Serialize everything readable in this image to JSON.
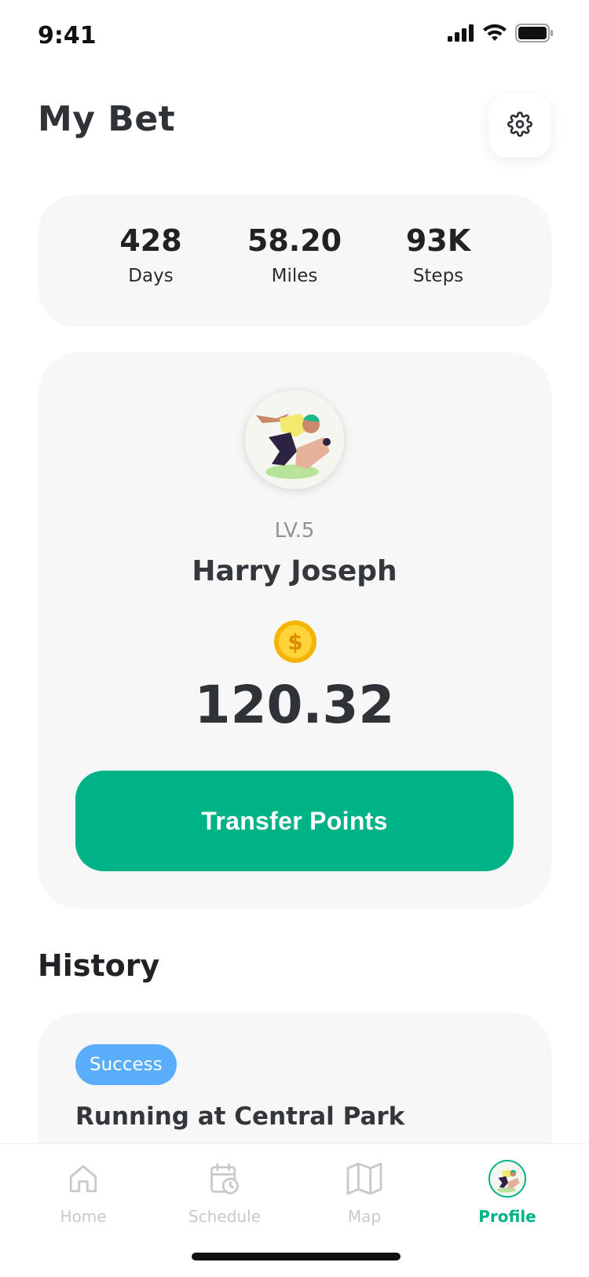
{
  "status_bar": {
    "time": "9:41",
    "icons": [
      "signal-icon",
      "wifi-icon",
      "battery-icon"
    ]
  },
  "header": {
    "title": "My Bet",
    "settings_icon": "gear-icon"
  },
  "stats": [
    {
      "value": "428",
      "label": "Days"
    },
    {
      "value": "58.20",
      "label": "Miles"
    },
    {
      "value": "93K",
      "label": "Steps"
    }
  ],
  "profile": {
    "level": "LV.5",
    "name": "Harry Joseph",
    "coin_icon": "dollar-coin-icon",
    "points": "120.32",
    "transfer_label": "Transfer Points"
  },
  "history": {
    "title": "History",
    "items": [
      {
        "status": "Success",
        "title": "Running at Central Park"
      }
    ]
  },
  "nav": {
    "items": [
      {
        "label": "Home",
        "icon": "home-icon",
        "active": false
      },
      {
        "label": "Schedule",
        "icon": "calendar-clock-icon",
        "active": false
      },
      {
        "label": "Map",
        "icon": "map-icon",
        "active": false
      },
      {
        "label": "Profile",
        "icon": "avatar-icon",
        "active": true
      }
    ]
  },
  "colors": {
    "accent": "#00b386",
    "badge": "#5aadfa",
    "card_bg": "#f7f7f7"
  }
}
